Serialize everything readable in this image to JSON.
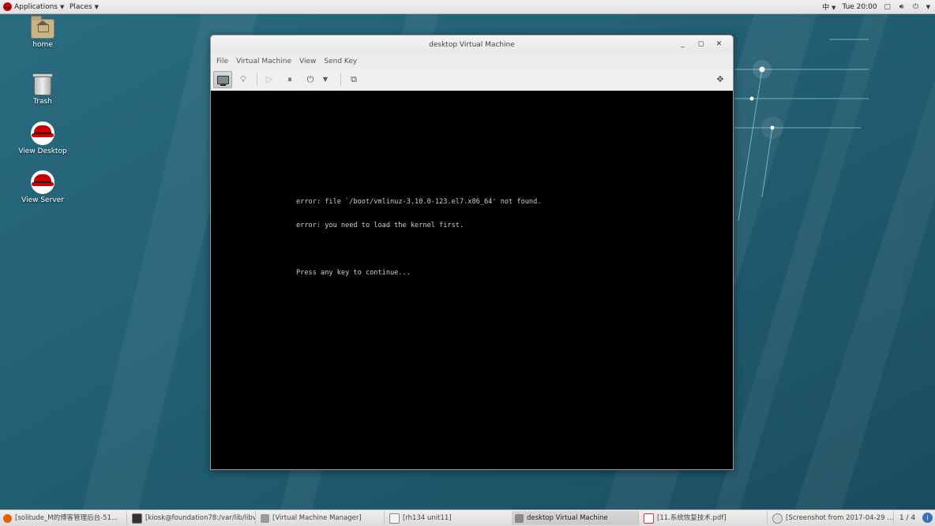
{
  "topbar": {
    "applications": "Applications",
    "places": "Places",
    "input_method": "中",
    "clock": "Tue 20:00"
  },
  "desktop": {
    "icons": [
      {
        "label": "home",
        "icon": "home-folder-icon"
      },
      {
        "label": "Trash",
        "icon": "trash-icon"
      },
      {
        "label": "View Desktop",
        "icon": "redhat-icon"
      },
      {
        "label": "View Server",
        "icon": "redhat-icon"
      }
    ]
  },
  "vm_window": {
    "title": "desktop Virtual Machine",
    "menu": [
      "File",
      "Virtual Machine",
      "View",
      "Send Key"
    ],
    "console_lines": [
      "error: file `/boot/vmlinuz-3.10.0-123.el7.x86_64' not found.",
      "error: you need to load the kernel first.",
      "",
      "Press any key to continue..."
    ]
  },
  "taskbar": {
    "items": [
      {
        "label": "[solitude_M的博客管理后台-51...",
        "icon": "firefox-icon",
        "active": false
      },
      {
        "label": "[kiosk@foundation78:/var/lib/libv...",
        "icon": "terminal-icon",
        "active": false
      },
      {
        "label": "[Virtual Machine Manager]",
        "icon": "virt-manager-icon",
        "active": false
      },
      {
        "label": "[rh134 unit11]",
        "icon": "document-icon",
        "active": false
      },
      {
        "label": "desktop Virtual Machine",
        "icon": "virt-manager-icon",
        "active": true
      },
      {
        "label": "[11.系统恢复技术.pdf]",
        "icon": "pdf-icon",
        "active": false
      },
      {
        "label": "[Screenshot from 2017-04-29 ...",
        "icon": "screenshot-icon",
        "active": false
      }
    ],
    "pager": "1 / 4"
  },
  "colors": {
    "desktop": "#1f5f74",
    "console_bg": "#000000",
    "console_text": "#cfcfcf"
  }
}
